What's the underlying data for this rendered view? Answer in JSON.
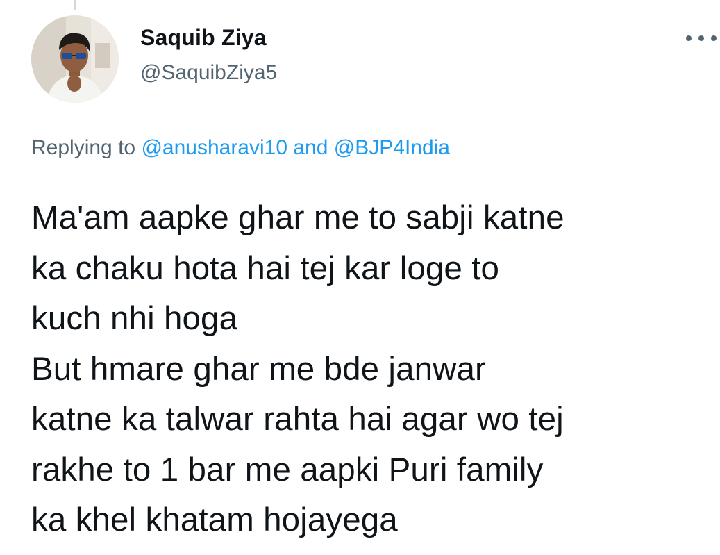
{
  "tweet": {
    "author": {
      "display_name": "Saquib Ziya",
      "handle": "@SaquibZiya5",
      "avatar_icon": "profile-photo"
    },
    "more_icon": "more-dots-icon",
    "reply": {
      "prefix": "Replying to",
      "mention_1": "@anusharavi10",
      "joiner": "and",
      "mention_2": "@BJP4India"
    },
    "text_lines": [
      "Ma'am aapke ghar me to sabji katne",
      "ka chaku hota hai tej kar loge to",
      "kuch nhi hoga",
      "But hmare ghar me bde janwar",
      "katne ka talwar rahta hai agar wo tej",
      "rakhe to 1 bar me aapki Puri family",
      "ka khel khatam hojayega"
    ]
  },
  "colors": {
    "text": "#0f1419",
    "secondary": "#536471",
    "link": "#1d9bf0",
    "thread_line": "#cfd9de"
  }
}
